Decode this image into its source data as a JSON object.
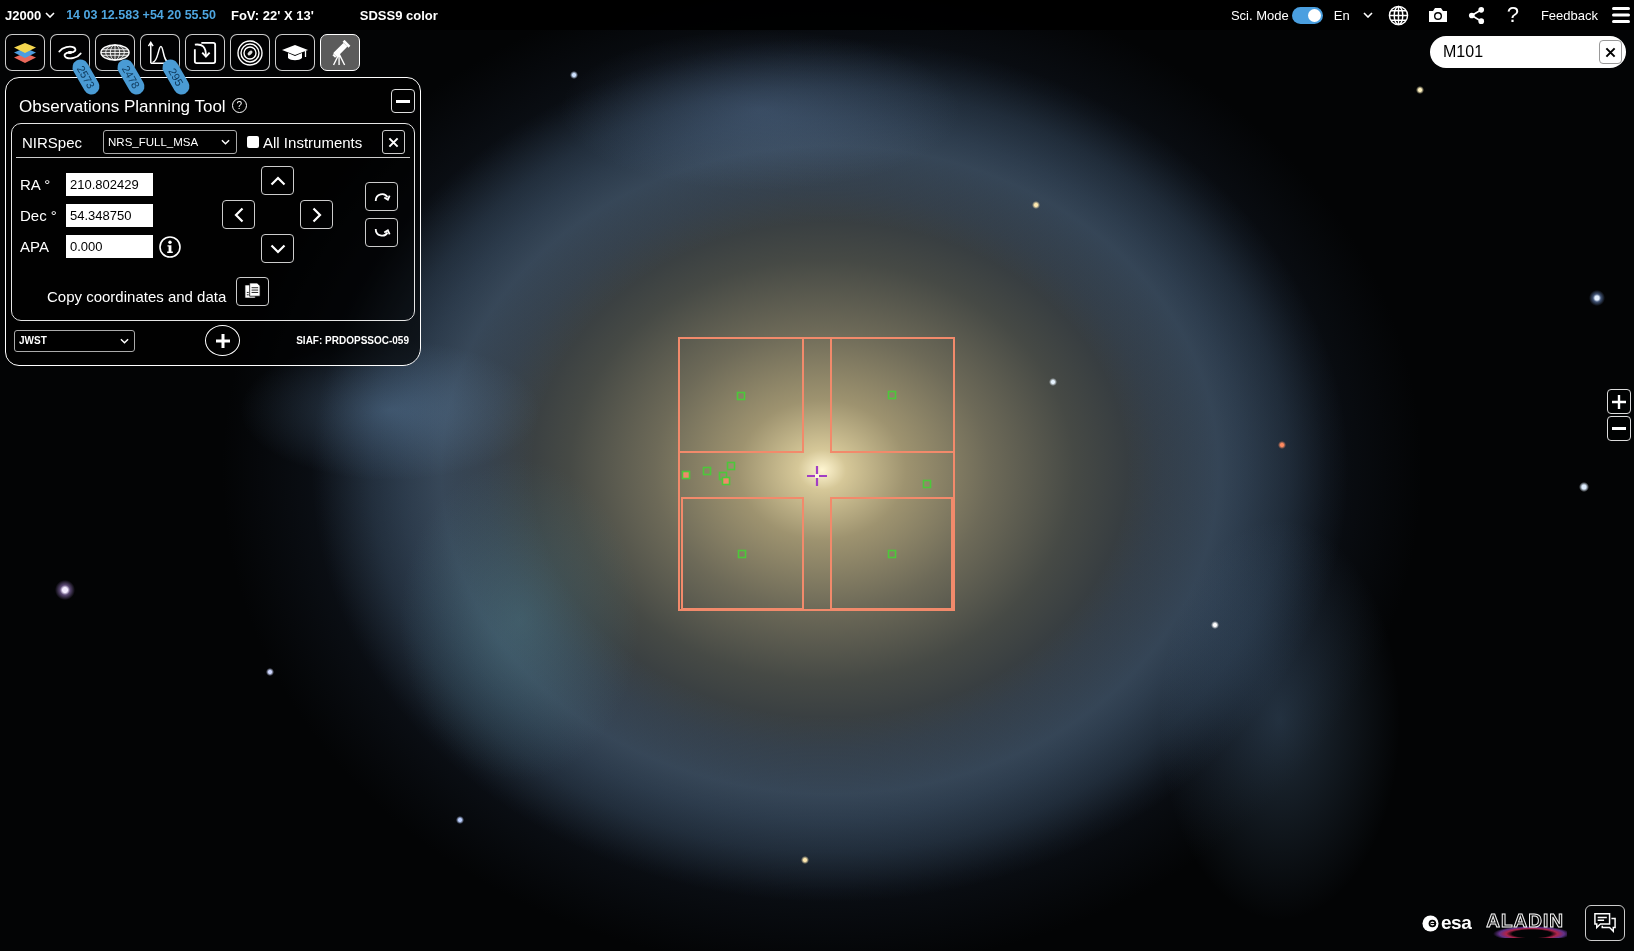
{
  "top_bar": {
    "frame": "J2000",
    "coordinates": "14 03 12.583 +54 20 55.50",
    "fov": "FoV: 22' X 13'",
    "survey": "SDSS9 color",
    "sci_mode": {
      "label": "Sci. Mode",
      "on": true
    },
    "language": "En",
    "help": "?",
    "feedback": "Feedback"
  },
  "toolbar": [
    {
      "kind": "layers",
      "selected": false
    },
    {
      "kind": "galaxy",
      "selected": false,
      "badge": "2573"
    },
    {
      "kind": "sky-grid",
      "selected": false,
      "badge": "2478"
    },
    {
      "kind": "spectrum",
      "selected": false,
      "badge": "295"
    },
    {
      "kind": "import",
      "selected": false
    },
    {
      "kind": "target",
      "selected": false
    },
    {
      "kind": "education",
      "selected": false
    },
    {
      "kind": "telescope",
      "selected": true
    }
  ],
  "search": {
    "value": "M101"
  },
  "planning_tool": {
    "title": "Observations Planning Tool",
    "help": "?",
    "instrument": "NIRSpec",
    "aperture": "NRS_FULL_MSA",
    "all_instruments": {
      "label": "All Instruments",
      "checked": false
    },
    "fields": [
      {
        "label": "RA °",
        "value": "210.802429",
        "info": false
      },
      {
        "label": "Dec °",
        "value": "54.348750",
        "info": false
      },
      {
        "label": "APA",
        "value": "0.000",
        "info": true
      }
    ],
    "copy_label": "Copy coordinates and data",
    "mission": "JWST",
    "siaf": "SIAF: PRDOPSSOC-059"
  },
  "logos": {
    "esa": "esa",
    "aladin": "ALADIN"
  }
}
